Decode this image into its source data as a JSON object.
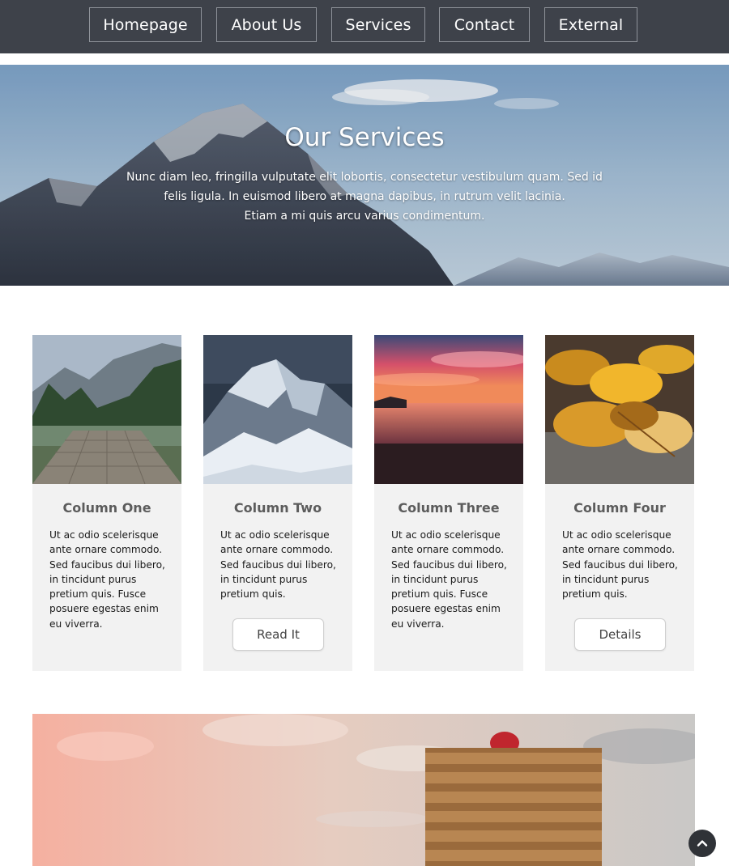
{
  "nav": {
    "items": [
      {
        "label": "Homepage"
      },
      {
        "label": "About Us"
      },
      {
        "label": "Services"
      },
      {
        "label": "Contact"
      },
      {
        "label": "External"
      }
    ]
  },
  "hero": {
    "title": "Our Services",
    "text_line1": "Nunc diam leo, fringilla vulputate elit lobortis, consectetur vestibulum quam. Sed id",
    "text_line2": "felis ligula. In euismod libero at magna dapibus, in rutrum velit lacinia.",
    "text_line3": "Etiam a mi quis arcu varius condimentum."
  },
  "columns": [
    {
      "title": "Column One",
      "text": "Ut ac odio scelerisque ante ornare commodo. Sed faucibus dui libero, in tincidunt purus pretium quis. Fusce posuere egestas enim eu viverra.",
      "button": ""
    },
    {
      "title": "Column Two",
      "text": "Ut ac odio scelerisque ante ornare commodo. Sed faucibus dui libero, in tincidunt purus pretium quis.",
      "button": "Read It"
    },
    {
      "title": "Column Three",
      "text": "Ut ac odio scelerisque ante ornare commodo. Sed faucibus dui libero, in tincidunt purus pretium quis. Fusce posuere egestas enim eu viverra.",
      "button": ""
    },
    {
      "title": "Column Four",
      "text": "Ut ac odio scelerisque ante ornare commodo. Sed faucibus dui libero, in tincidunt purus pretium quis.",
      "button": "Details"
    }
  ],
  "icons": {
    "back_to_top": "chevron-up-icon"
  },
  "colors": {
    "navbar_bg": "#3e424a",
    "card_bg": "#f2f2f2",
    "back_to_top_bg": "#2f3237"
  }
}
